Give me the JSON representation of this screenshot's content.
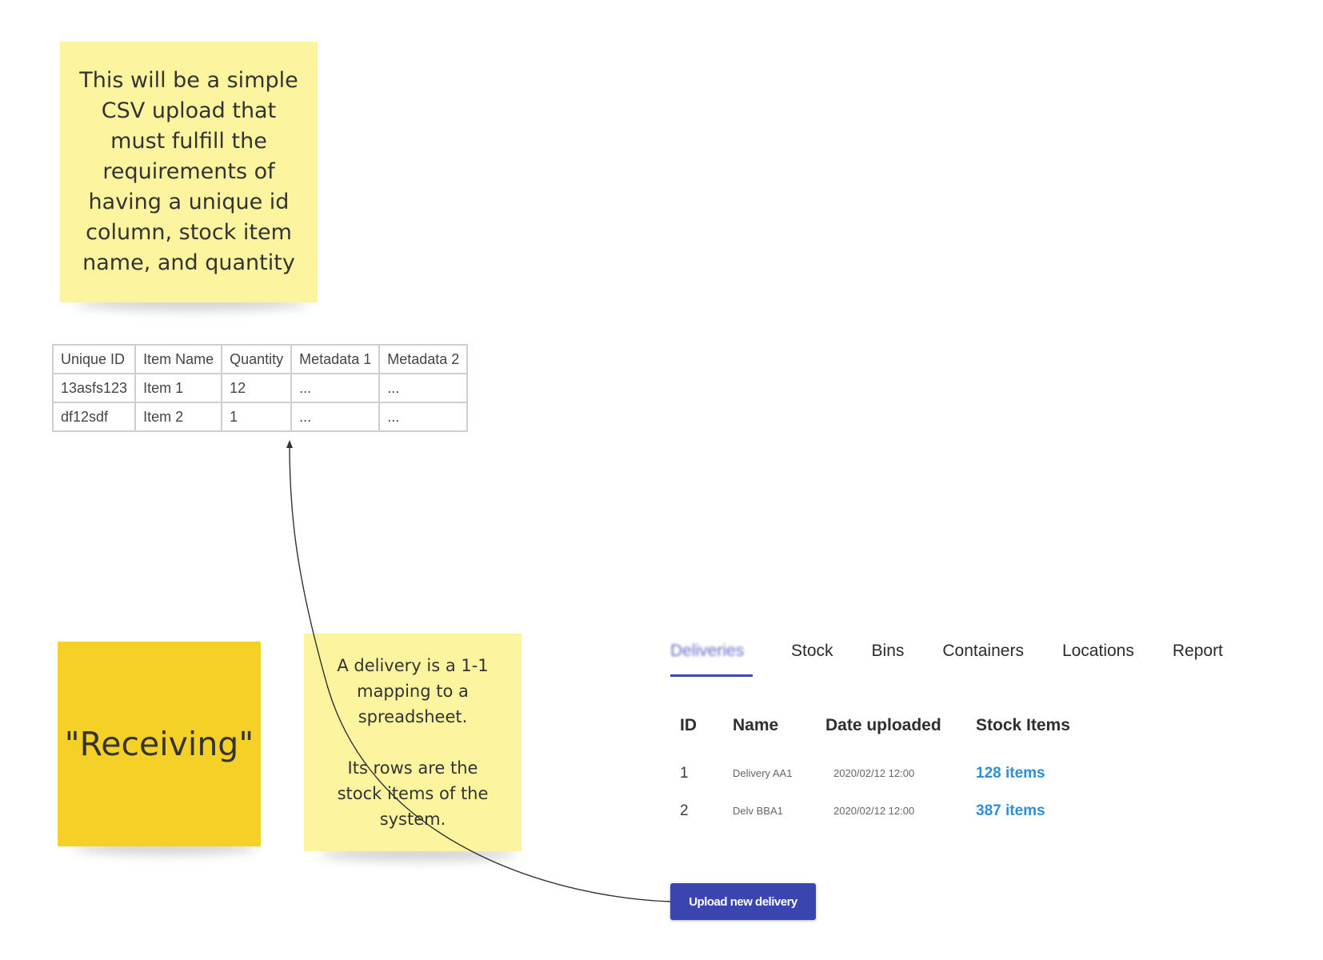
{
  "notes": {
    "csv_requirements": "This will be a simple\nCSV upload that\nmust fulfill the\nrequirements of\nhaving a unique id\ncolumn, stock item\nname, and quantity",
    "receiving": "\"Receiving\"",
    "delivery_mapping": "A delivery is a 1-1\nmapping to a\nspreadsheet.\n\nIts rows are the\nstock items of the\nsystem."
  },
  "csv_table": {
    "headers": [
      "Unique ID",
      "Item Name",
      "Quantity",
      "Metadata 1",
      "Metadata 2"
    ],
    "rows": [
      [
        "13asfs123",
        "Item 1",
        "12",
        "...",
        "..."
      ],
      [
        "df12sdf",
        "Item 2",
        "1",
        "...",
        "..."
      ]
    ]
  },
  "app": {
    "tabs": [
      "Deliveries",
      "Stock",
      "Bins",
      "Containers",
      "Locations",
      "Report"
    ],
    "active_tab": 0,
    "table": {
      "headers": [
        "ID",
        "Name",
        "Date uploaded",
        "Stock Items"
      ],
      "rows": [
        {
          "id": "1",
          "name": "Delivery AA1",
          "date": "2020/02/12 12:00",
          "items": "128 items"
        },
        {
          "id": "2",
          "name": "Delv BBA1",
          "date": "2020/02/12 12:00",
          "items": "387 items"
        }
      ]
    },
    "upload_button": "Upload new delivery"
  },
  "colors": {
    "sticky_light": "#fdf49f",
    "sticky_dark": "#f5d128",
    "accent": "#3a45b0",
    "link": "#2f8fd6"
  }
}
